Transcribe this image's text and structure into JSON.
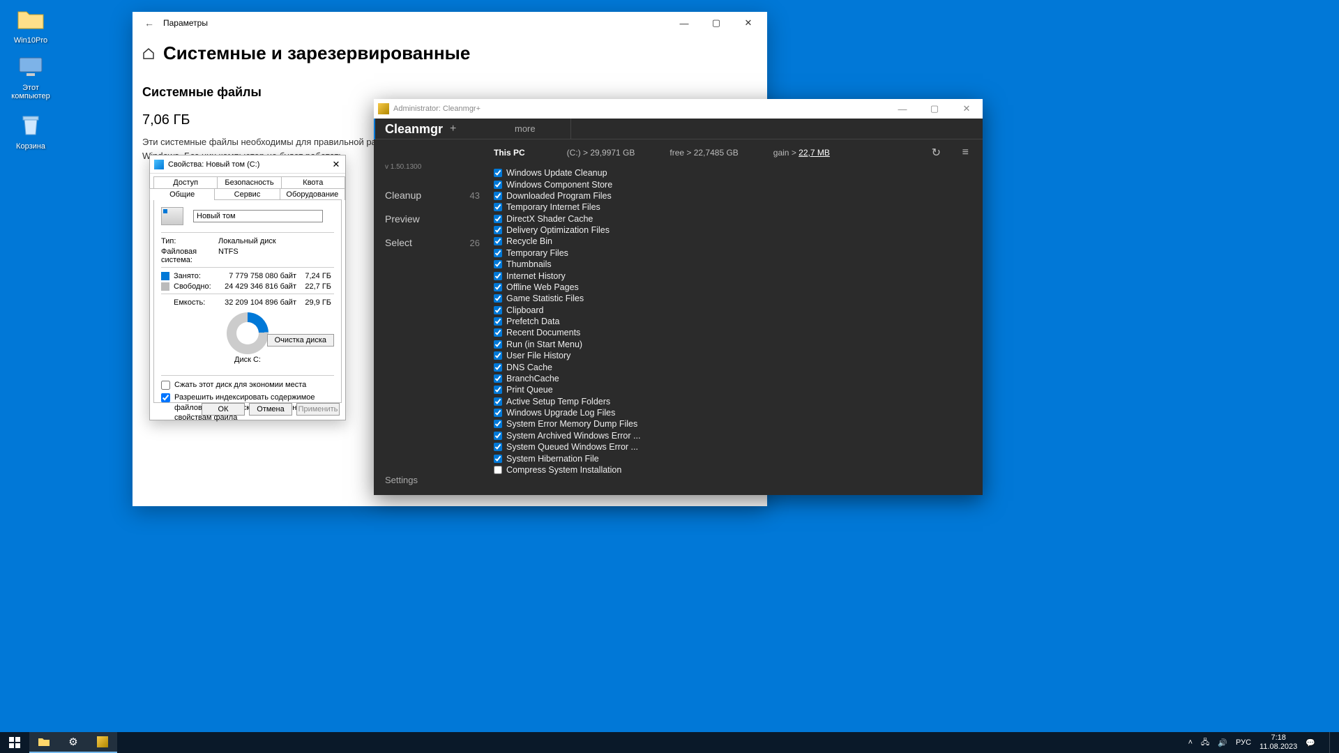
{
  "desktop": {
    "icons": [
      {
        "label": "Win10Pro"
      },
      {
        "label": "Этот\nкомпьютер"
      },
      {
        "label": "Корзина"
      }
    ]
  },
  "settings": {
    "title": "Параметры",
    "heading": "Системные и зарезервированные",
    "section": "Системные файлы",
    "size": "7,06 ГБ",
    "desc": "Эти системные файлы необходимы для правильной работы Windows. Без них компьютер не будет работать."
  },
  "props": {
    "title": "Свойства: Новый том (C:)",
    "tabs_row1": [
      "Доступ",
      "Безопасность",
      "Квота"
    ],
    "tabs_row2": [
      "Общие",
      "Сервис",
      "Оборудование"
    ],
    "active_tab": "Общие",
    "volume_name": "Новый том",
    "type_label": "Тип:",
    "type_value": "Локальный диск",
    "fs_label": "Файловая система:",
    "fs_value": "NTFS",
    "used_label": "Занято:",
    "used_bytes": "7 779 758 080 байт",
    "used_gb": "7,24 ГБ",
    "free_label": "Свободно:",
    "free_bytes": "24 429 346 816 байт",
    "free_gb": "22,7 ГБ",
    "cap_label": "Емкость:",
    "cap_bytes": "32 209 104 896 байт",
    "cap_gb": "29,9 ГБ",
    "disk_label": "Диск C:",
    "cleanup_btn": "Очистка диска",
    "compress": "Сжать этот диск для экономии места",
    "index": "Разрешить индексировать содержимое файлов на этом диске в дополнение к свойствам файла",
    "ok": "ОК",
    "cancel": "Отмена",
    "apply": "Применить"
  },
  "clean": {
    "title": "Administrator: Cleanmgr+",
    "brand": "Cleanmgr",
    "version": "v 1.50.1300",
    "more": "more",
    "side": {
      "cleanup": "Cleanup",
      "cleanup_count": "43",
      "preview": "Preview",
      "select": "Select",
      "select_count": "26",
      "settings": "Settings"
    },
    "stats": {
      "thispc": "This PC",
      "disk": "(C:) > 29,9971 GB",
      "free": "free >  22,7485 GB",
      "gain": "gain >",
      "gain_val": "22,7 MB"
    },
    "items": [
      {
        "label": "Windows Update Cleanup",
        "checked": true
      },
      {
        "label": "Windows Component Store",
        "checked": true
      },
      {
        "label": "Downloaded Program Files",
        "checked": true
      },
      {
        "label": "Temporary Internet Files",
        "checked": true
      },
      {
        "label": "DirectX Shader Cache",
        "checked": true
      },
      {
        "label": "Delivery Optimization Files",
        "checked": true
      },
      {
        "label": "Recycle Bin",
        "checked": true
      },
      {
        "label": "Temporary Files",
        "checked": true
      },
      {
        "label": "Thumbnails",
        "checked": true
      },
      {
        "label": "Internet History",
        "checked": true
      },
      {
        "label": "Offline Web Pages",
        "checked": true
      },
      {
        "label": "Game Statistic Files",
        "checked": true
      },
      {
        "label": "Clipboard",
        "checked": true
      },
      {
        "label": "Prefetch Data",
        "checked": true
      },
      {
        "label": "Recent Documents",
        "checked": true
      },
      {
        "label": "Run (in Start Menu)",
        "checked": true
      },
      {
        "label": "User File History",
        "checked": true
      },
      {
        "label": "DNS Cache",
        "checked": true
      },
      {
        "label": "BranchCache",
        "checked": true
      },
      {
        "label": "Print Queue",
        "checked": true
      },
      {
        "label": "Active Setup Temp Folders",
        "checked": true
      },
      {
        "label": "Windows Upgrade Log Files",
        "checked": true
      },
      {
        "label": "System Error Memory Dump Files",
        "checked": true
      },
      {
        "label": "System Archived Windows Error ...",
        "checked": true
      },
      {
        "label": "System Queued Windows Error ...",
        "checked": true
      },
      {
        "label": "System Hibernation File",
        "checked": true
      },
      {
        "label": "Compress System Installation",
        "checked": false
      }
    ]
  },
  "taskbar": {
    "lang": "РУС",
    "time": "7:18",
    "date": "11.08.2023"
  }
}
